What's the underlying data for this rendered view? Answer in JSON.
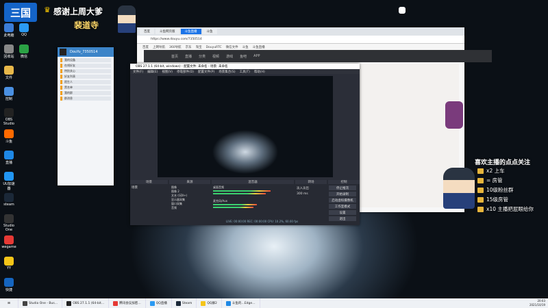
{
  "overlay": {
    "logo": "三国",
    "thanks_title": "感谢上周大爹",
    "thanks_name": "裴道寺",
    "promo_title": "喜欢主播的点点关注",
    "promo_items": [
      {
        "icon": "gift-icon",
        "text": "x2 上车"
      },
      {
        "icon": "gift-icon",
        "text": "= 房管"
      },
      {
        "icon": "gift-icon",
        "text": "10级粉丝群"
      },
      {
        "icon": "gift-icon",
        "text": "15级房管"
      },
      {
        "icon": "gift-icon",
        "text": "x10 主播把屁眼给你"
      }
    ]
  },
  "desktop_icons": [
    {
      "label": "此电脑",
      "color": "#3b7dd8"
    },
    {
      "label": "回收站",
      "color": "#888888"
    },
    {
      "label": "文件",
      "color": "#e8b84a"
    },
    {
      "label": "控制",
      "color": "#4a90e2"
    },
    {
      "label": "OBS Studio",
      "color": "#222222"
    },
    {
      "label": "斗鱼",
      "color": "#ff6a00"
    },
    {
      "label": "直播",
      "color": "#1e88e5"
    },
    {
      "label": "UU加速器",
      "color": "#2196f3"
    },
    {
      "label": "steam",
      "color": "#1b2838"
    },
    {
      "label": "Studio One",
      "color": "#333333"
    },
    {
      "label": "wegame",
      "color": "#e53935"
    },
    {
      "label": "YY",
      "color": "#f5c518"
    },
    {
      "label": "快捷",
      "color": "#1565c0"
    }
  ],
  "desktop_icons_col2": [
    {
      "label": "QQ",
      "color": "#2b9af3"
    },
    {
      "label": "微信",
      "color": "#2ba245"
    }
  ],
  "qq": {
    "title": "DouYu_7350514",
    "items": [
      "我的设备",
      "在线好友",
      "特别关心",
      "好友列表",
      "陌生人",
      "黑名单",
      "我的群",
      "群消息"
    ]
  },
  "browser": {
    "tabs": [
      "百度",
      "斗鱼网页版",
      "斗鱼直播",
      "斗鱼"
    ],
    "url": "https://www.douyu.com/7350514",
    "bookmarks": [
      "百度",
      "上网导航",
      "360导航",
      "京东",
      "淘宝",
      "DouyuRTC",
      "微信文件",
      "斗鱼",
      "斗鱼直播"
    ]
  },
  "douyu_nav": [
    "首页",
    "直播",
    "分类",
    "视频",
    "游戏",
    "鱼吧",
    "APP"
  ],
  "obs": {
    "title": "OBS 27.1.1 (64-bit, windows) - 配置文件: 未命名 - 场景: 未命名",
    "menu": [
      "文件(F)",
      "编辑(E)",
      "视图(V)",
      "停靠部件(D)",
      "配置文件(P)",
      "场景集合(S)",
      "工具(T)",
      "帮助(H)"
    ],
    "docks": [
      "场景",
      "来源",
      "混音器",
      "转场",
      "控制"
    ],
    "scene": "场景",
    "sources": [
      "图像",
      "图像 2",
      "文本 (GDI+)",
      "显示器采集",
      "窗口采集",
      "音频"
    ],
    "mixer": [
      {
        "name": "桌面音频",
        "level": 0.72
      },
      {
        "name": "麦克风/Aux",
        "level": 0.55
      }
    ],
    "transition": {
      "label": "淡入淡出",
      "duration": "300 ms"
    },
    "controls": [
      "停止推流",
      "开始录制",
      "启动虚拟摄像机",
      "工作室模式",
      "设置",
      "退出"
    ],
    "status": "LIVE: 00:00:00   REC: 00:00:00   CPU: 10.2%, 60.00 fps"
  },
  "taskbar": {
    "items": [
      {
        "label": "Studio One - Bus…",
        "color": "#444444"
      },
      {
        "label": "OBS 27.1.1 (64-bit…",
        "color": "#222222"
      },
      {
        "label": "腾讯会议加密…",
        "color": "#e53935"
      },
      {
        "label": "QQ直播",
        "color": "#2b9af3"
      },
      {
        "label": "Steam",
        "color": "#1b2838"
      },
      {
        "label": "QQ群2",
        "color": "#f5c518"
      },
      {
        "label": "斗鱼的…Edge…",
        "color": "#1e88e5"
      }
    ],
    "time": "20:03",
    "date": "2021/10/19"
  }
}
